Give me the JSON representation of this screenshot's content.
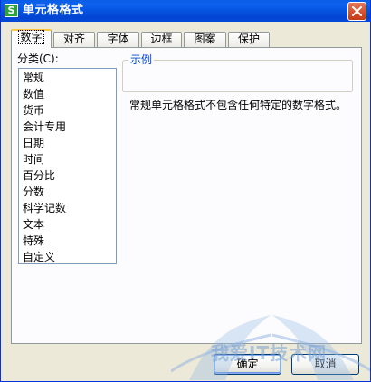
{
  "window": {
    "title": "单元格格式",
    "app_icon": "S",
    "close_icon": "close-icon"
  },
  "tabs": [
    {
      "label": "数字",
      "active": true
    },
    {
      "label": "对齐"
    },
    {
      "label": "字体"
    },
    {
      "label": "边框"
    },
    {
      "label": "图案"
    },
    {
      "label": "保护"
    }
  ],
  "category": {
    "label": "分类(C):",
    "items": [
      "常规",
      "数值",
      "货币",
      "会计专用",
      "日期",
      "时间",
      "百分比",
      "分数",
      "科学记数",
      "文本",
      "特殊",
      "自定义"
    ]
  },
  "sample": {
    "legend": "示例"
  },
  "description": "常规单元格格式不包含任何特定的数字格式。",
  "buttons": {
    "ok": "确定",
    "cancel": "取消"
  },
  "watermark": "我爱IT技术网",
  "colors": {
    "titlebar": "#0553e0",
    "close": "#d8532f",
    "active_tab_accent": "#ffc83c",
    "legend": "#0046d5"
  }
}
